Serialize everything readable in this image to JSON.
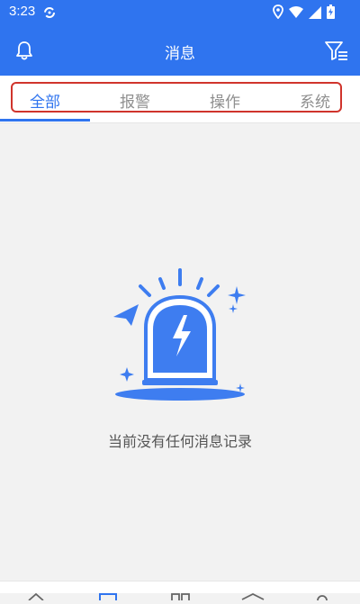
{
  "status_bar": {
    "time": "3:23",
    "icons": [
      "sync-icon",
      "location-icon",
      "wifi-icon",
      "cellular-icon",
      "battery-icon"
    ]
  },
  "header": {
    "title": "消息",
    "left_icon": "bell-icon",
    "right_icon": "filter-icon"
  },
  "tabs": [
    {
      "label": "全部",
      "active": true
    },
    {
      "label": "报警",
      "active": false
    },
    {
      "label": "操作",
      "active": false
    },
    {
      "label": "系统",
      "active": false
    }
  ],
  "empty_state": {
    "icon": "alarm-light-icon",
    "message": "当前没有任何消息记录"
  },
  "bottom_nav": {
    "icons": [
      "home-icon",
      "messages-icon",
      "grid-icon",
      "layers-icon",
      "profile-icon"
    ],
    "active_index": 1
  },
  "colors": {
    "primary": "#2f74ef",
    "highlight_border": "#d0342c",
    "inactive_tab": "#8f8f8f",
    "background": "#f2f2f2"
  }
}
